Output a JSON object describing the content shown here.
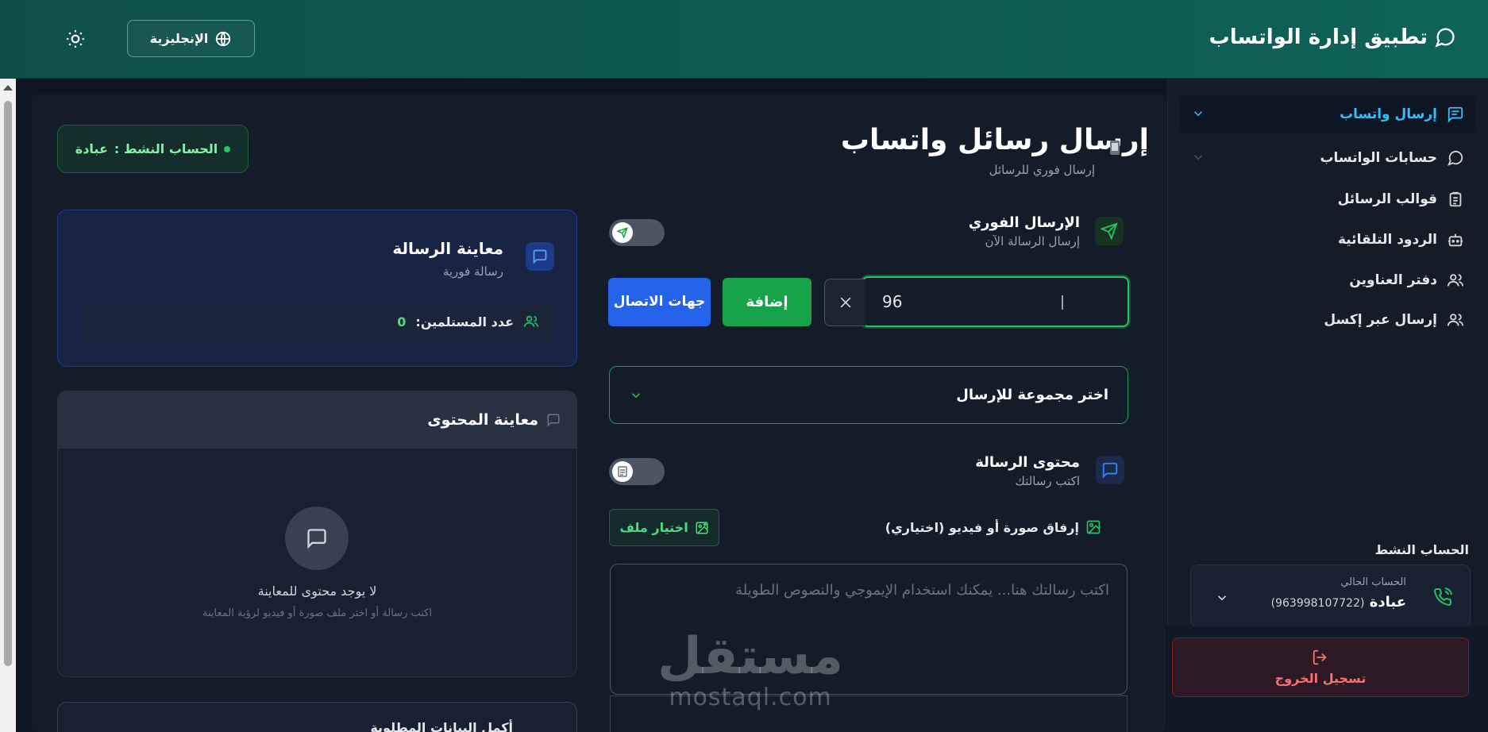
{
  "header": {
    "app_title": "تطبيق إدارة الواتساب",
    "language_button": "الإنجليزية"
  },
  "sidebar": {
    "items": [
      {
        "label": "إرسال واتساب",
        "active": true
      },
      {
        "label": "حسابات الواتساب",
        "active": false
      },
      {
        "label": "قوالب الرسائل",
        "active": false
      },
      {
        "label": "الردود التلقائية",
        "active": false
      },
      {
        "label": "دفتر العناوين",
        "active": false
      },
      {
        "label": "إرسال عبر إكسل",
        "active": false
      }
    ],
    "active_account_title": "الحساب النشط",
    "current_account_label": "الحساب الحالي",
    "current_account_name": "عبادة",
    "current_account_phone": "(963998107722)",
    "logout_label": "تسجيل الخروج"
  },
  "main": {
    "title": "إرسال رسائل واتساب",
    "subtitle": "إرسال فوري للرسائل",
    "active_badge_label": "الحساب النشط :",
    "active_badge_name": "عبادة",
    "instant_send": {
      "title": "الإرسال الفوري",
      "subtitle": "إرسال الرسالة الآن"
    },
    "number_input_value": "96",
    "add_button": "إضافة",
    "contacts_button": "جهات الاتصال",
    "group_select_placeholder": "اختر مجموعة للإرسال",
    "message_content": {
      "title": "محتوى الرسالة",
      "subtitle": "اكتب رسالتك"
    },
    "attach_label": "إرفاق صورة أو فيديو (اختياري)",
    "file_button": "اختيار ملف",
    "message_placeholder": "اكتب رسالتك هنا... يمكنك استخدام الإيموجي والنصوص الطويلة"
  },
  "preview": {
    "title": "معاينة الرسالة",
    "subtitle": "رسالة فورية",
    "recipients_label": "عدد المستلمين:",
    "recipients_count": "0",
    "content_title": "معاينة المحتوى",
    "empty_title": "لا يوجد محتوى للمعاينة",
    "empty_subtitle": "اكتب رسالة أو اختر ملف صورة أو فيديو لرؤية المعاينة",
    "bottom_card_title": "أكمل البيانات المطلوبة"
  },
  "watermark": {
    "arabic": "مستقل",
    "latin": "mostaql.com"
  },
  "colors": {
    "accent_green": "#22c55e",
    "accent_blue": "#2563eb",
    "header_teal": "#0f5a52",
    "danger": "#f87171"
  }
}
